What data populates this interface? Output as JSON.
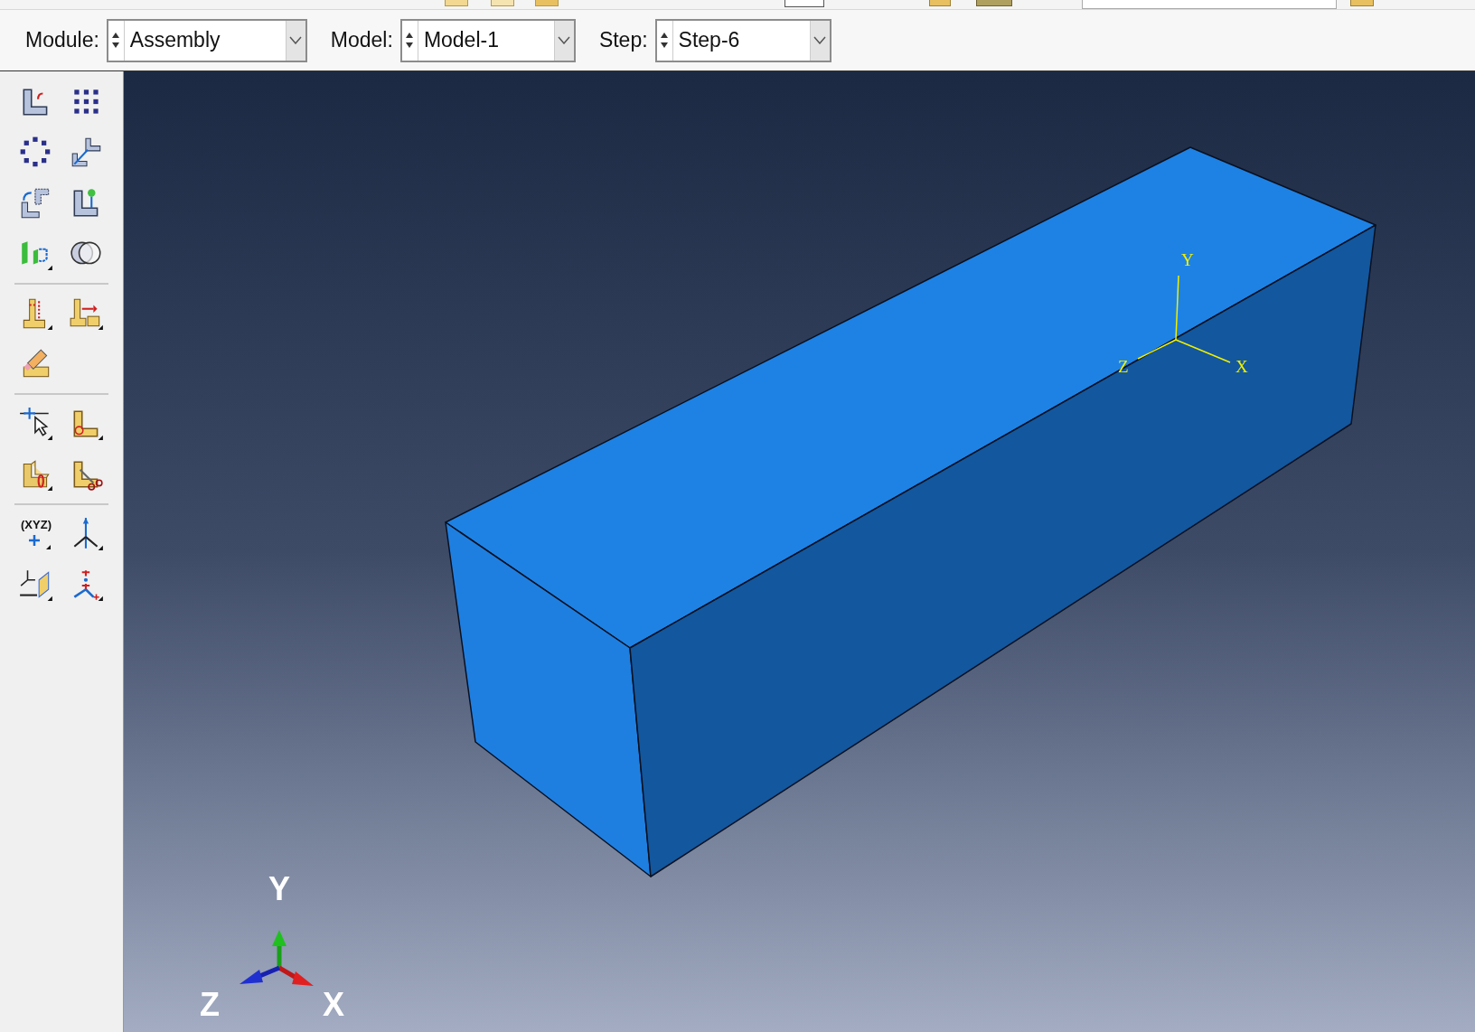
{
  "context_bar": [
    {
      "label": "Module:",
      "value": "Assembly"
    },
    {
      "label": "Model:",
      "value": "Model-1"
    },
    {
      "label": "Step:",
      "value": "Step-6"
    }
  ],
  "toolbox": {
    "datum_point_text": "(XYZ)"
  },
  "viewport": {
    "part_csys": {
      "x": "X",
      "y": "Y",
      "z": "Z"
    },
    "view_triad": {
      "x": "X",
      "y": "Y",
      "z": "Z"
    }
  }
}
